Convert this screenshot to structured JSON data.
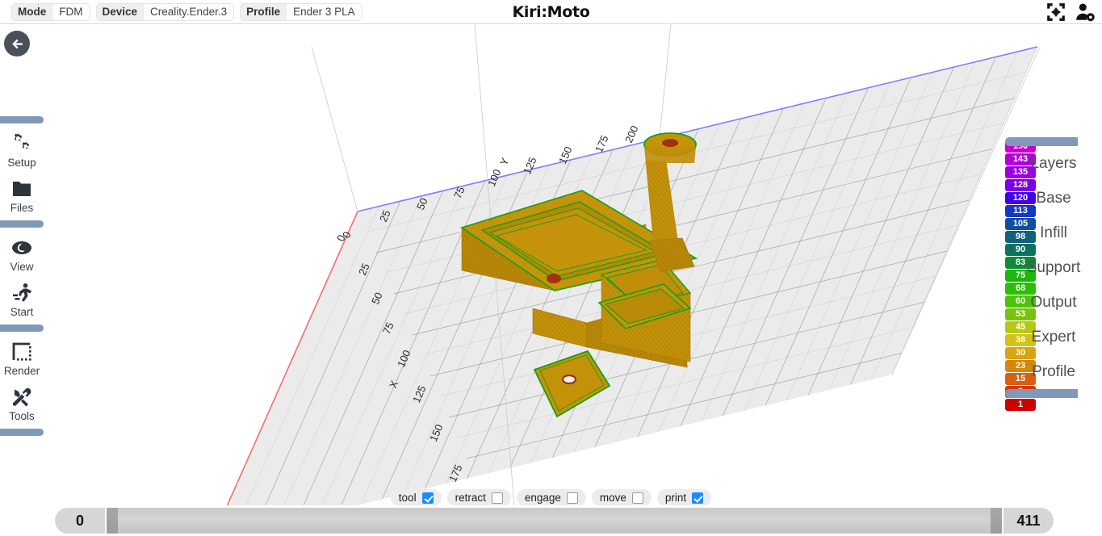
{
  "topbar": {
    "title": "Kiri:Moto",
    "settings": [
      {
        "key": "Mode",
        "value": "FDM"
      },
      {
        "key": "Device",
        "value": "Creality.Ender.3"
      },
      {
        "key": "Profile",
        "value": "Ender 3 PLA"
      }
    ],
    "icons": [
      {
        "name": "fullscreen-arrows-icon"
      },
      {
        "name": "user-settings-icon"
      }
    ]
  },
  "back_button": {
    "icon": "arrow-left-icon"
  },
  "sidebar": {
    "items": [
      {
        "label": "Setup",
        "icon": "gears-icon"
      },
      {
        "label": "Files",
        "icon": "folder-icon"
      },
      {
        "label": "View",
        "icon": "eye-icon"
      },
      {
        "label": "Start",
        "icon": "running-person-icon"
      },
      {
        "label": "Render",
        "icon": "dashed-square-icon"
      },
      {
        "label": "Tools",
        "icon": "wrench-screwdriver-icon"
      }
    ]
  },
  "right_menu": {
    "items": [
      {
        "label": "Layers"
      },
      {
        "label": "Base"
      },
      {
        "label": "Infill"
      },
      {
        "label": "Support"
      },
      {
        "label": "Output"
      },
      {
        "label": "Expert"
      },
      {
        "label": "Profile"
      }
    ]
  },
  "layer_scale": [
    {
      "value": "150",
      "color": "#cc00cc"
    },
    {
      "value": "143",
      "color": "#b200d8"
    },
    {
      "value": "135",
      "color": "#9900e0"
    },
    {
      "value": "128",
      "color": "#7a00e6"
    },
    {
      "value": "120",
      "color": "#4000e6"
    },
    {
      "value": "113",
      "color": "#1438c4"
    },
    {
      "value": "105",
      "color": "#0f4f9e"
    },
    {
      "value": "98",
      "color": "#10607e"
    },
    {
      "value": "90",
      "color": "#0d7060"
    },
    {
      "value": "83",
      "color": "#0c8a36"
    },
    {
      "value": "75",
      "color": "#1ab80c"
    },
    {
      "value": "68",
      "color": "#2cbf06"
    },
    {
      "value": "60",
      "color": "#4cc406"
    },
    {
      "value": "53",
      "color": "#79c10a"
    },
    {
      "value": "45",
      "color": "#b8c717"
    },
    {
      "value": "38",
      "color": "#d4c215"
    },
    {
      "value": "30",
      "color": "#d8a511"
    },
    {
      "value": "23",
      "color": "#d4870f"
    },
    {
      "value": "15",
      "color": "#d6600d"
    },
    {
      "value": "8",
      "color": "#d4380a"
    },
    {
      "value": "1",
      "color": "#cc0000"
    }
  ],
  "toggles": [
    {
      "label": "tool",
      "checked": true
    },
    {
      "label": "retract",
      "checked": false
    },
    {
      "label": "engage",
      "checked": false
    },
    {
      "label": "move",
      "checked": false
    },
    {
      "label": "print",
      "checked": true
    }
  ],
  "range_slider": {
    "min_value": "0",
    "max_value": "411"
  },
  "viewport": {
    "axis_x_label": "X",
    "axis_y_label": "Y",
    "x_ticks": [
      "0",
      "25",
      "50",
      "75",
      "100",
      "125",
      "150",
      "175"
    ],
    "y_ticks": [
      "0",
      "25",
      "50",
      "75",
      "100",
      "125",
      "150",
      "175",
      "200"
    ],
    "colors": {
      "grid_plate": "#ebebeb",
      "grid_line": "#9a9a9a",
      "axis_x": "#f06060",
      "axis_y": "#8080f0",
      "model_fill": "#c8960a",
      "model_fill_dark": "#a87b08",
      "model_fill_light": "#d9a915",
      "outline_green": "#14a014",
      "hole_red": "#a03010"
    }
  }
}
